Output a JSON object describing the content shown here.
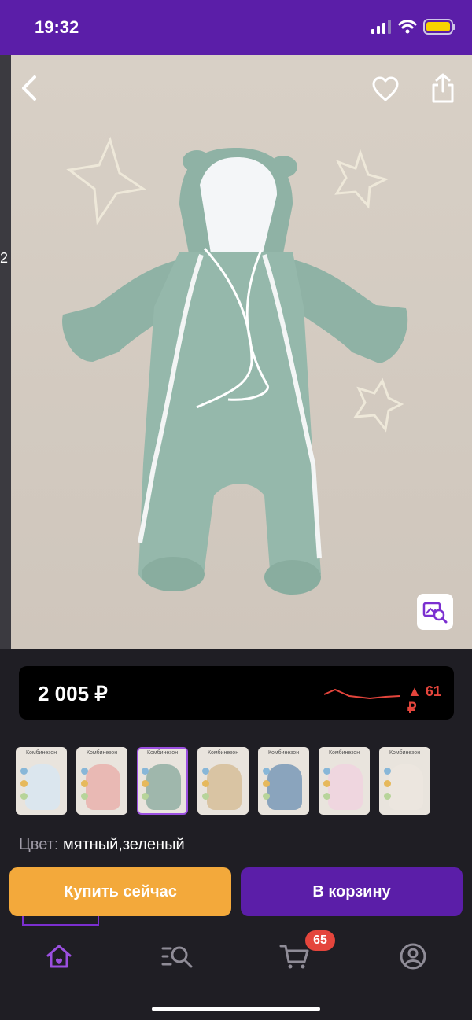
{
  "status_bar": {
    "time": "19:32"
  },
  "product": {
    "left_edge_digit": "2",
    "price": "2 005 ₽",
    "price_change": "▲ 61 ₽",
    "color_label": "Цвет:",
    "color_value": "мятный,зеленый",
    "thumbnails": [
      {
        "title": "Комбинезон",
        "tone": "#dbe6ee"
      },
      {
        "title": "Комбинезон",
        "tone": "#e9b9b4"
      },
      {
        "title": "Комбинезон",
        "tone": "#9fb7ac"
      },
      {
        "title": "Комбинезон",
        "tone": "#d9c4a3"
      },
      {
        "title": "Комбинезон",
        "tone": "#8aa4bd"
      },
      {
        "title": "Комбинезон",
        "tone": "#efd6df"
      },
      {
        "title": "Комбинезон",
        "tone": "#ece6df"
      }
    ],
    "selected_thumbnail": 3
  },
  "actions": {
    "buy_now": "Купить сейчас",
    "add_to_cart": "В корзину"
  },
  "tabbar": {
    "cart_badge": "65"
  },
  "colors": {
    "brand": "#5b1ea8",
    "buy": "#f3a93b",
    "alert": "#e4453c",
    "accent": "#9b4fe0"
  }
}
